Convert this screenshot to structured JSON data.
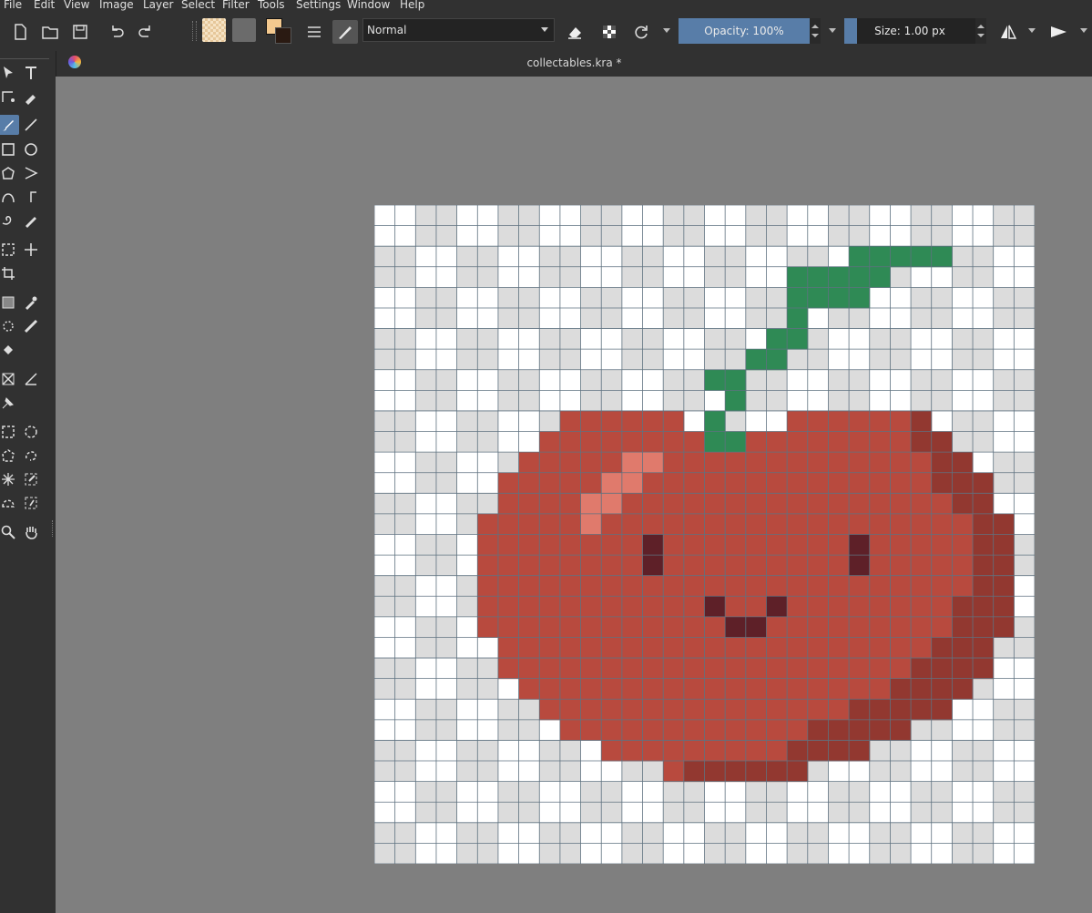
{
  "menu": [
    "File",
    "Edit",
    "View",
    "Image",
    "Layer",
    "Select",
    "Filter",
    "Tools",
    "Settings",
    "Window",
    "Help"
  ],
  "toolbar": {
    "blend_mode": "Normal",
    "opacity_label": "Opacity: 100%",
    "opacity_value": 1.0,
    "size_label": "Size: 1.00 px",
    "foreground_color": "#f4c98f",
    "background_color": "#2a1a12"
  },
  "document": {
    "title": "collectables.kra *"
  },
  "colors": {
    "ui_bg": "#313131",
    "canvas_bg": "#7f7f7f",
    "accent": "#587da8"
  },
  "artwork": {
    "grid_size": 32,
    "palette": {
      "R": "#b84a3e",
      "D": "#923830",
      "H": "#e07a6c",
      "E": "#5e2028",
      "G": "#2f8a55"
    },
    "rows": [
      "................................",
      "................................",
      "...................... GGGGG....",
      "....................GGGGG.......",
      "....................GGGG........",
      "....................G...........",
      "...................GG...........",
      "..................GG............",
      "................GG..............",
      ".................G..............",
      ".........RRRRRR.G...RRRRRRD.....",
      "........RRRRRRRRGGRRRRRRRRDD....",
      ".......RRRRRHHRRRRRRRRRRRRRDD...",
      "......RRRRRHHRRRRRRRRRRRRRRDDD..",
      "......RRRRHHRRRRRRRRRRRRRRRRDD..",
      ".....RRRRRHRRRRRRRRRRRRRRRRRRDD.",
      ".....RRRRRRRRERRRRRRRRRERRRRRDD.",
      ".....RRRRRRRRERRRRRRRRRERRRRRDD.",
      ".....RRRRRRRRRRRRRRRRRRRRRRRRDD.",
      ".....RRRRRRRRRRRERRERRRRRRRRDDD.",
      ".....RRRRRRRRRRRREERRRRRRRRRDDD.",
      "......RRRRRRRRRRRRRRRRRRRRRDDD..",
      "......RRRRRRRRRRRRRRRRRRRRDDDD..",
      ".......RRRRRRRRRRRRRRRRRRDDDD...",
      "........RRRRRRRRRRRRRRRDDDDD....",
      ".........RRRRRRRRRRRRDDDDD......",
      "...........RRRRRRRRRDDDD........",
      "..............RDDDDDD...........",
      "................................",
      "................................",
      "................................",
      "................................"
    ]
  }
}
